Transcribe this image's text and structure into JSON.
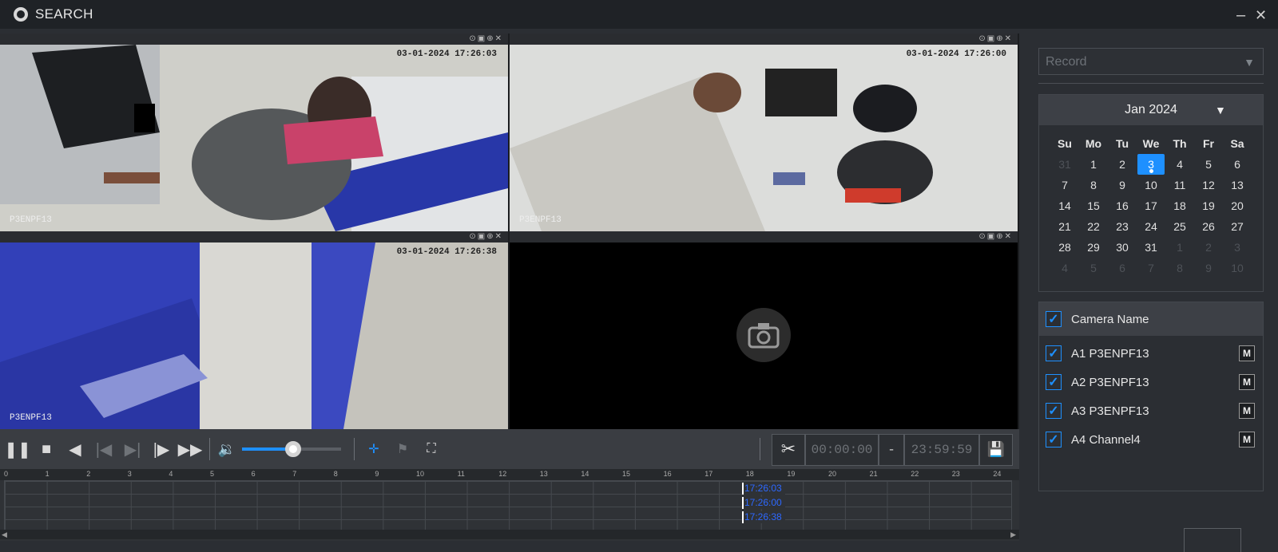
{
  "window": {
    "title": "SEARCH",
    "minimize": "–",
    "close": "✕"
  },
  "panes": [
    {
      "timestamp": "03-01-2024 17:26:03",
      "camera_label": "P3ENPF13",
      "tools": "⊙▣⊕✕"
    },
    {
      "timestamp": "03-01-2024 17:26:00",
      "camera_label": "P3ENPF13",
      "tools": "⊙▣⊕✕"
    },
    {
      "timestamp": "03-01-2024 17:26:38",
      "camera_label": "P3ENPF13",
      "tools": "⊙▣⊕✕"
    },
    {
      "timestamp": "",
      "camera_label": "",
      "tools": "⊙▣⊕✕"
    }
  ],
  "controls": {
    "volume_percent": 52,
    "clip_start": "00:00:00",
    "clip_dash": "-",
    "clip_end": "23:59:59"
  },
  "timeline": {
    "hours": [
      "0",
      "1",
      "2",
      "3",
      "4",
      "5",
      "6",
      "7",
      "8",
      "9",
      "10",
      "11",
      "12",
      "13",
      "14",
      "15",
      "16",
      "17",
      "18",
      "19",
      "20",
      "21",
      "22",
      "23",
      "24"
    ],
    "marks": [
      "17:26:03",
      "17:26:00",
      "17:26:38"
    ]
  },
  "sidebar": {
    "record_type": "Record",
    "calendar": {
      "month_label": "Jan 2024",
      "weekdays": [
        "Su",
        "Mo",
        "Tu",
        "We",
        "Th",
        "Fr",
        "Sa"
      ],
      "days": [
        "31",
        "1",
        "2",
        "3",
        "4",
        "5",
        "6",
        "7",
        "8",
        "9",
        "10",
        "11",
        "12",
        "13",
        "14",
        "15",
        "16",
        "17",
        "18",
        "19",
        "20",
        "21",
        "22",
        "23",
        "24",
        "25",
        "26",
        "27",
        "28",
        "29",
        "30",
        "31",
        "1",
        "2",
        "3",
        "4",
        "5",
        "6",
        "7",
        "8",
        "9",
        "10"
      ],
      "selected_day": "3"
    },
    "camera_list": {
      "header": "Camera Name",
      "cameras": [
        {
          "name": "A1 P3ENPF13",
          "m": "M"
        },
        {
          "name": "A2 P3ENPF13",
          "m": "M"
        },
        {
          "name": "A3 P3ENPF13",
          "m": "M"
        },
        {
          "name": "A4 Channel4",
          "m": "M"
        }
      ]
    }
  },
  "colors": {
    "accent": "#1e90ff",
    "selected_pane": "#3cb043",
    "timeline_mark": "#2d68ff"
  }
}
